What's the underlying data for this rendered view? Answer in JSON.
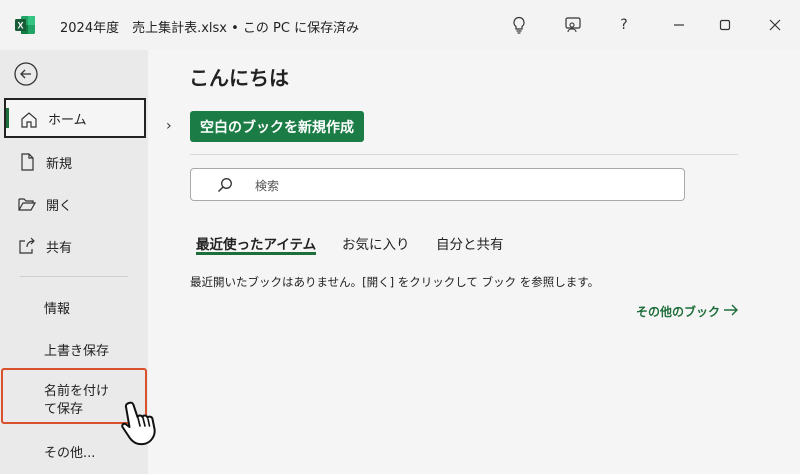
{
  "window": {
    "title": "2024年度　売上集計表.xlsx • この PC に保存済み",
    "help_label": "?"
  },
  "sidebar": {
    "items": [
      {
        "label": "ホーム"
      },
      {
        "label": "新規"
      },
      {
        "label": "開く"
      },
      {
        "label": "共有"
      }
    ],
    "secondary": [
      {
        "label": "情報"
      },
      {
        "label": "上書き保存"
      },
      {
        "label": "名前を付けて保存"
      },
      {
        "label": "その他..."
      }
    ]
  },
  "main": {
    "greeting": "こんにちは",
    "new_blank_label": "空白のブックを新規作成",
    "search_placeholder": "検索",
    "tabs": [
      {
        "label": "最近使ったアイテム"
      },
      {
        "label": "お気に入り"
      },
      {
        "label": "自分と共有"
      }
    ],
    "empty_message": "最近開いたブックはありません。[開く] をクリックして ブック を参照します。",
    "more_books_label": "その他のブック"
  },
  "colors": {
    "accent": "#1b7d45",
    "highlight": "#d9512c"
  }
}
